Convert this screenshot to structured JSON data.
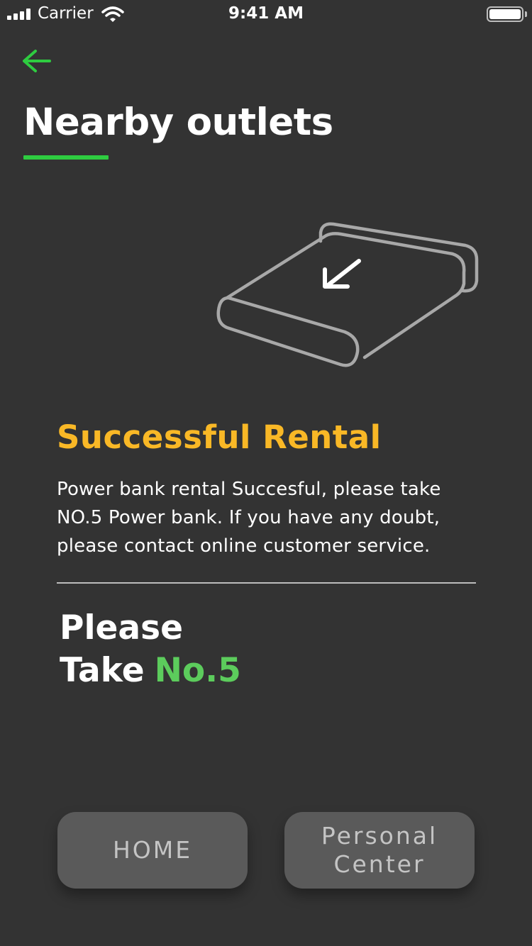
{
  "status_bar": {
    "carrier": "Carrier",
    "time": "9:41 AM",
    "icons": [
      "signal-icon",
      "wifi-icon",
      "battery-icon"
    ]
  },
  "header": {
    "back_icon": "arrow-left-icon",
    "title": "Nearby outlets",
    "accent_color": "#2ecc40"
  },
  "illustration": {
    "icon": "power-bank-return-icon"
  },
  "result": {
    "title": "Successful Rental",
    "title_color": "#f9b826",
    "message": "Power bank rental Succesful, please take NO.5 Power bank. If you have any doubt, please contact online customer service."
  },
  "take": {
    "line1": "Please",
    "line2": "Take",
    "number": "No.5",
    "number_color": "#5ccc5c"
  },
  "buttons": {
    "home_label": "HOME",
    "personal_label": "Personal Center"
  }
}
